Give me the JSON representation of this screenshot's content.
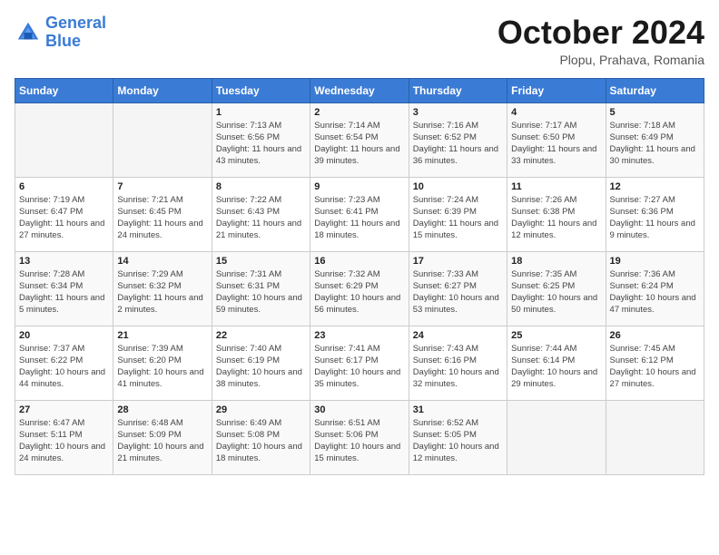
{
  "header": {
    "logo_line1": "General",
    "logo_line2": "Blue",
    "month": "October 2024",
    "location": "Plopu, Prahava, Romania"
  },
  "weekdays": [
    "Sunday",
    "Monday",
    "Tuesday",
    "Wednesday",
    "Thursday",
    "Friday",
    "Saturday"
  ],
  "weeks": [
    [
      {
        "day": "",
        "sunrise": "",
        "sunset": "",
        "daylight": ""
      },
      {
        "day": "",
        "sunrise": "",
        "sunset": "",
        "daylight": ""
      },
      {
        "day": "1",
        "sunrise": "Sunrise: 7:13 AM",
        "sunset": "Sunset: 6:56 PM",
        "daylight": "Daylight: 11 hours and 43 minutes."
      },
      {
        "day": "2",
        "sunrise": "Sunrise: 7:14 AM",
        "sunset": "Sunset: 6:54 PM",
        "daylight": "Daylight: 11 hours and 39 minutes."
      },
      {
        "day": "3",
        "sunrise": "Sunrise: 7:16 AM",
        "sunset": "Sunset: 6:52 PM",
        "daylight": "Daylight: 11 hours and 36 minutes."
      },
      {
        "day": "4",
        "sunrise": "Sunrise: 7:17 AM",
        "sunset": "Sunset: 6:50 PM",
        "daylight": "Daylight: 11 hours and 33 minutes."
      },
      {
        "day": "5",
        "sunrise": "Sunrise: 7:18 AM",
        "sunset": "Sunset: 6:49 PM",
        "daylight": "Daylight: 11 hours and 30 minutes."
      }
    ],
    [
      {
        "day": "6",
        "sunrise": "Sunrise: 7:19 AM",
        "sunset": "Sunset: 6:47 PM",
        "daylight": "Daylight: 11 hours and 27 minutes."
      },
      {
        "day": "7",
        "sunrise": "Sunrise: 7:21 AM",
        "sunset": "Sunset: 6:45 PM",
        "daylight": "Daylight: 11 hours and 24 minutes."
      },
      {
        "day": "8",
        "sunrise": "Sunrise: 7:22 AM",
        "sunset": "Sunset: 6:43 PM",
        "daylight": "Daylight: 11 hours and 21 minutes."
      },
      {
        "day": "9",
        "sunrise": "Sunrise: 7:23 AM",
        "sunset": "Sunset: 6:41 PM",
        "daylight": "Daylight: 11 hours and 18 minutes."
      },
      {
        "day": "10",
        "sunrise": "Sunrise: 7:24 AM",
        "sunset": "Sunset: 6:39 PM",
        "daylight": "Daylight: 11 hours and 15 minutes."
      },
      {
        "day": "11",
        "sunrise": "Sunrise: 7:26 AM",
        "sunset": "Sunset: 6:38 PM",
        "daylight": "Daylight: 11 hours and 12 minutes."
      },
      {
        "day": "12",
        "sunrise": "Sunrise: 7:27 AM",
        "sunset": "Sunset: 6:36 PM",
        "daylight": "Daylight: 11 hours and 9 minutes."
      }
    ],
    [
      {
        "day": "13",
        "sunrise": "Sunrise: 7:28 AM",
        "sunset": "Sunset: 6:34 PM",
        "daylight": "Daylight: 11 hours and 5 minutes."
      },
      {
        "day": "14",
        "sunrise": "Sunrise: 7:29 AM",
        "sunset": "Sunset: 6:32 PM",
        "daylight": "Daylight: 11 hours and 2 minutes."
      },
      {
        "day": "15",
        "sunrise": "Sunrise: 7:31 AM",
        "sunset": "Sunset: 6:31 PM",
        "daylight": "Daylight: 10 hours and 59 minutes."
      },
      {
        "day": "16",
        "sunrise": "Sunrise: 7:32 AM",
        "sunset": "Sunset: 6:29 PM",
        "daylight": "Daylight: 10 hours and 56 minutes."
      },
      {
        "day": "17",
        "sunrise": "Sunrise: 7:33 AM",
        "sunset": "Sunset: 6:27 PM",
        "daylight": "Daylight: 10 hours and 53 minutes."
      },
      {
        "day": "18",
        "sunrise": "Sunrise: 7:35 AM",
        "sunset": "Sunset: 6:25 PM",
        "daylight": "Daylight: 10 hours and 50 minutes."
      },
      {
        "day": "19",
        "sunrise": "Sunrise: 7:36 AM",
        "sunset": "Sunset: 6:24 PM",
        "daylight": "Daylight: 10 hours and 47 minutes."
      }
    ],
    [
      {
        "day": "20",
        "sunrise": "Sunrise: 7:37 AM",
        "sunset": "Sunset: 6:22 PM",
        "daylight": "Daylight: 10 hours and 44 minutes."
      },
      {
        "day": "21",
        "sunrise": "Sunrise: 7:39 AM",
        "sunset": "Sunset: 6:20 PM",
        "daylight": "Daylight: 10 hours and 41 minutes."
      },
      {
        "day": "22",
        "sunrise": "Sunrise: 7:40 AM",
        "sunset": "Sunset: 6:19 PM",
        "daylight": "Daylight: 10 hours and 38 minutes."
      },
      {
        "day": "23",
        "sunrise": "Sunrise: 7:41 AM",
        "sunset": "Sunset: 6:17 PM",
        "daylight": "Daylight: 10 hours and 35 minutes."
      },
      {
        "day": "24",
        "sunrise": "Sunrise: 7:43 AM",
        "sunset": "Sunset: 6:16 PM",
        "daylight": "Daylight: 10 hours and 32 minutes."
      },
      {
        "day": "25",
        "sunrise": "Sunrise: 7:44 AM",
        "sunset": "Sunset: 6:14 PM",
        "daylight": "Daylight: 10 hours and 29 minutes."
      },
      {
        "day": "26",
        "sunrise": "Sunrise: 7:45 AM",
        "sunset": "Sunset: 6:12 PM",
        "daylight": "Daylight: 10 hours and 27 minutes."
      }
    ],
    [
      {
        "day": "27",
        "sunrise": "Sunrise: 6:47 AM",
        "sunset": "Sunset: 5:11 PM",
        "daylight": "Daylight: 10 hours and 24 minutes."
      },
      {
        "day": "28",
        "sunrise": "Sunrise: 6:48 AM",
        "sunset": "Sunset: 5:09 PM",
        "daylight": "Daylight: 10 hours and 21 minutes."
      },
      {
        "day": "29",
        "sunrise": "Sunrise: 6:49 AM",
        "sunset": "Sunset: 5:08 PM",
        "daylight": "Daylight: 10 hours and 18 minutes."
      },
      {
        "day": "30",
        "sunrise": "Sunrise: 6:51 AM",
        "sunset": "Sunset: 5:06 PM",
        "daylight": "Daylight: 10 hours and 15 minutes."
      },
      {
        "day": "31",
        "sunrise": "Sunrise: 6:52 AM",
        "sunset": "Sunset: 5:05 PM",
        "daylight": "Daylight: 10 hours and 12 minutes."
      },
      {
        "day": "",
        "sunrise": "",
        "sunset": "",
        "daylight": ""
      },
      {
        "day": "",
        "sunrise": "",
        "sunset": "",
        "daylight": ""
      }
    ]
  ]
}
